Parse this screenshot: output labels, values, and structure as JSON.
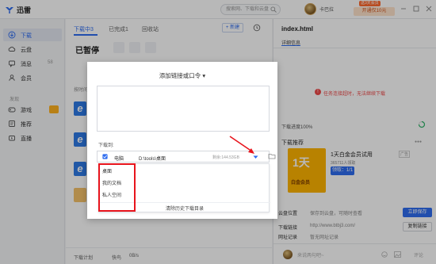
{
  "app": {
    "name": "迅雷"
  },
  "header": {
    "search_placeholder": "搜索网、下载和云盘",
    "username": "卡巴拉",
    "vip_promo_tag": "送3天会员",
    "vip_promo_label": "开通仅10元"
  },
  "sidebar": {
    "items": [
      {
        "label": "下载",
        "icon": "download-icon"
      },
      {
        "label": "云盘",
        "icon": "cloud-icon"
      },
      {
        "label": "消息",
        "icon": "message-icon",
        "count": "58"
      },
      {
        "label": "会员",
        "icon": "vip-icon"
      }
    ],
    "section": "发现",
    "discover": [
      {
        "label": "游戏",
        "icon": "game-icon"
      },
      {
        "label": "推荐",
        "icon": "recommend-icon"
      },
      {
        "label": "直播",
        "icon": "live-icon"
      }
    ]
  },
  "main": {
    "tabs": [
      "下载中3",
      "已完成1",
      "回收站"
    ],
    "new_button": "+ 新建",
    "paused_title": "已暂停",
    "section_label": "按时间",
    "bottom": {
      "plan": "下载计划",
      "speed_label": "快鸟",
      "speed": "0B/s"
    }
  },
  "dialog": {
    "title": "添加链接或口令",
    "download_to_label": "下载到:",
    "target": "电脑",
    "path": "D:\\tools\\桌面",
    "free_space": "剩余:144.53GB",
    "options": [
      "桌面",
      "我的文档",
      "私人空间"
    ],
    "clear_history": "清除历史下载目录"
  },
  "details": {
    "title": "index.html",
    "tab": "详细信息",
    "error": "任务连接超时，无法继续下载",
    "progress": "下载进度100%",
    "rec_label": "下载推荐",
    "rec_title": "1天白金会员试用",
    "rec_ad": "广告",
    "rec_count": "365711人领取",
    "rec_claim": "领取：1/1",
    "rec_img_big": "1天",
    "rec_img_small": "白金会员",
    "rows": [
      {
        "label": "云盘位置",
        "value": "保存到云盘，可随时查看"
      },
      {
        "label": "下载链接",
        "value": "http://www.btbj3.com/"
      },
      {
        "label": "网址记录",
        "value": "暂无网址记录"
      }
    ],
    "open_save": "立即保存",
    "copy_link": "复制链接",
    "comment_placeholder": "来说两句吧~",
    "comment_send": "评论"
  }
}
